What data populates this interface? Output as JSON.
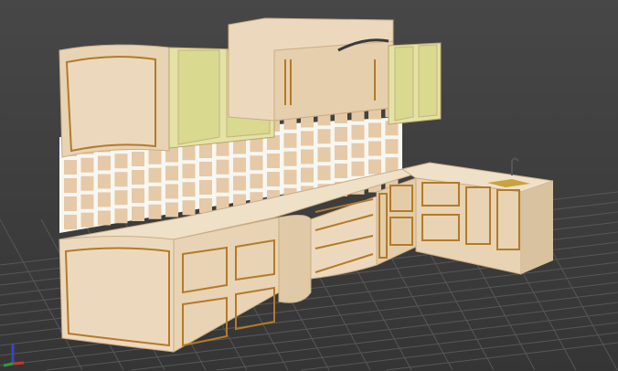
{
  "scene": {
    "subject": "kitchen-model",
    "colors": {
      "background": "#3f3f3f",
      "grid": "#5a5a5a",
      "cabinet": "#ecd9bd",
      "cabinet_shade": "#d9c2a0",
      "trim": "#b47a2a",
      "glass": "#e3e3a6",
      "tile": "#e6c9a7",
      "grout": "#f7f7f2",
      "axis_x": "#c0392b",
      "axis_y": "#2e9b3a",
      "axis_z": "#3a45b8"
    }
  }
}
